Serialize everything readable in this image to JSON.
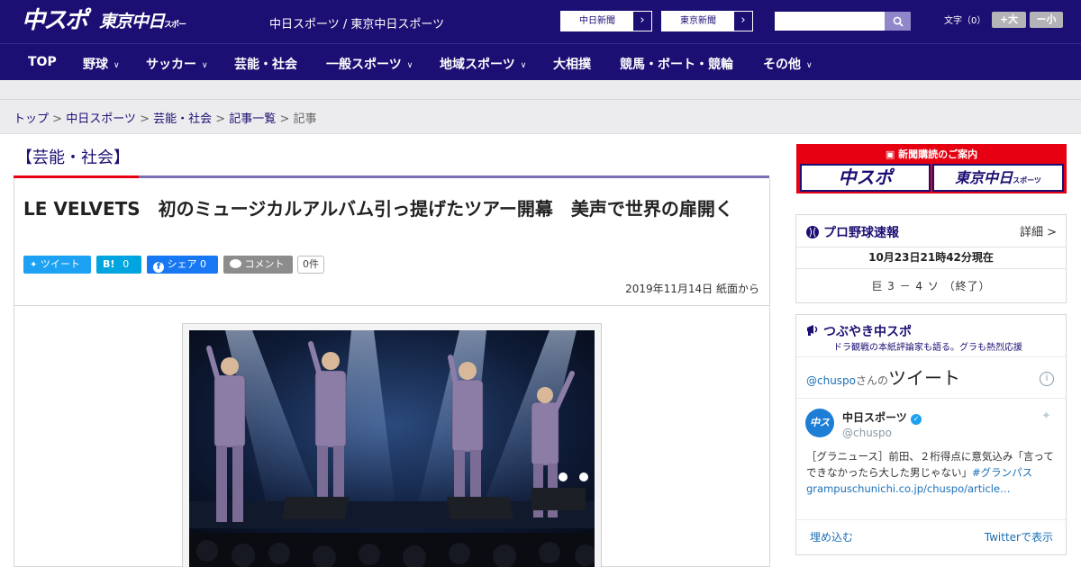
{
  "header": {
    "logo_chunichi": "中スポ",
    "logo_tokyo": "東京中日",
    "logo_tokyo_small": "スポーツ",
    "links": "中日スポーツ / 東京中日スポーツ",
    "paper_btn_1": "中日新聞",
    "paper_btn_2": "東京新聞",
    "font_label": "文字（0）",
    "font_larger": "+大",
    "font_smaller": "ー小",
    "accent_color": "#1b0f73",
    "search_icon": "search-icon"
  },
  "nav": {
    "items": [
      "TOP",
      "野球",
      "サッカー",
      "芸能・社会",
      "一般スポーツ",
      "地域スポーツ",
      "大相撲",
      "競馬・ボート・競輪",
      "その他"
    ]
  },
  "breadcrumb": {
    "top": "トップ",
    "sep": " > ",
    "chunichi": "中日スポーツ",
    "category": "芸能・社会",
    "list": "記事一覧",
    "current": "記事"
  },
  "article": {
    "section": "【芸能・社会】",
    "headline": "LE VELVETS　初のミュージカルアルバム引っ提げたツアー開幕　美声で世界の扉開く",
    "tweet_label": "ツイート",
    "hatena_label": "B!",
    "hatena_count": "0",
    "share_label": "シェア",
    "share_count": "0",
    "comment_label": "コメント",
    "comment_count": "0件",
    "date": "2019年11月14日 紙面から",
    "accent_red": "#e60012"
  },
  "sidebar": {
    "subscribe_title": "新聞購読のご案内",
    "subscribe_logo_1": "中スポ",
    "subscribe_logo_2": "東京中日",
    "subscribe_logo_2_small": "スポーツ",
    "baseball_title": "プロ野球速報",
    "baseball_more": "詳細 >",
    "baseball_time": "10月23日21時42分現在",
    "baseball_score": "巨 3 － 4 ソ （終了）",
    "tweet_title": "つぶやき中スポ",
    "tweet_sub": "ドラ観戦の本紙評論家も語る。グラも熱烈応援",
    "tweet_handle_prefix": "@chuspo",
    "tweet_handle_suffix": "さんの",
    "tweet_word": "ツイート",
    "tweet_user": "中日スポーツ",
    "tweet_user_handle": "@chuspo",
    "tweet_text": "［グラニュース］前田、２桁得点に意気込み「言ってできなかったら大した男じゃない」",
    "tweet_hashtag": "#グランパス",
    "tweet_link": "grampuschunichi.co.jp/chuspo/article…",
    "tweet_embed": "埋め込む",
    "tweet_view": "Twitterで表示"
  }
}
